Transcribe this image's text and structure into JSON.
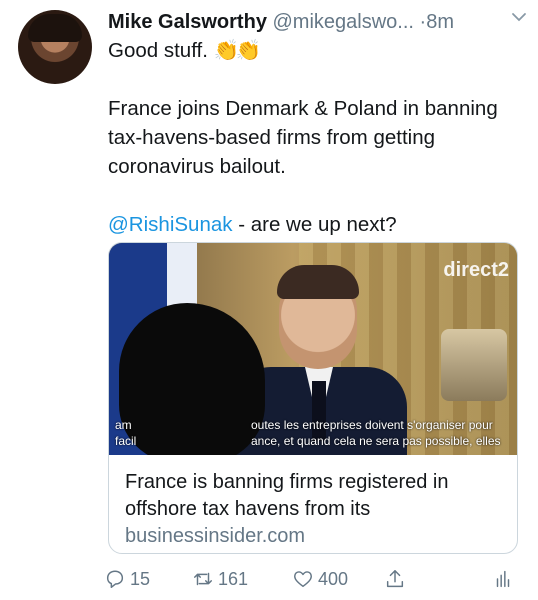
{
  "tweet": {
    "author_name": "Mike Galsworthy",
    "handle": "@mikegalswo...",
    "dot": "·",
    "time": "8m",
    "text": {
      "line1": "Good stuff.",
      "emoji": [
        "👏",
        "👏"
      ],
      "paragraph2": "France joins Denmark & Poland in banning tax-havens-based firms from getting coronavirus bailout.",
      "mention": "@RishiSunak",
      "after_mention": " - are we up next?"
    }
  },
  "card": {
    "image": {
      "tv_logo_text": "direct",
      "tv_logo_number": "2",
      "caption_left_line1": "am",
      "caption_left_line2": "facil",
      "caption_right_line1": "outes les entreprises doivent s'organiser pour",
      "caption_right_line2": "ance, et quand cela ne sera pas possible, elles"
    },
    "title": "France is banning firms registered in offshore tax havens from its",
    "domain": "businessinsider.com"
  },
  "actions": {
    "reply_count": "15",
    "retweet_count": "161",
    "like_count": "400"
  },
  "icons": {
    "reply": "reply-icon",
    "retweet": "retweet-icon",
    "like": "heart-icon",
    "share": "share-icon",
    "analytics": "analytics-icon",
    "chevron": "chevron-down-icon"
  },
  "colors": {
    "link": "#1b95e0",
    "muted": "#657786"
  }
}
